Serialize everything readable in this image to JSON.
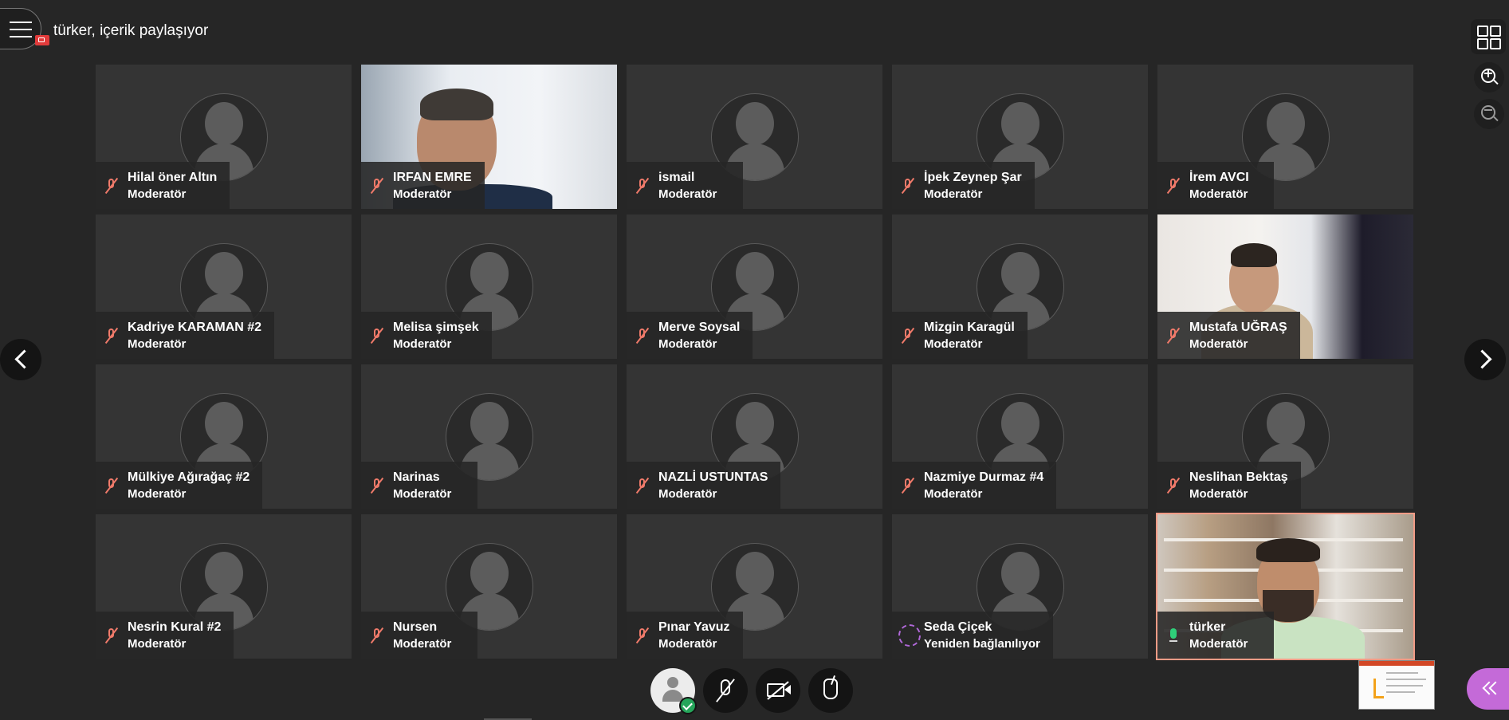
{
  "presenter": "türker, içerik paylaşıyor",
  "participants": [
    {
      "name": "Hilal öner Altın",
      "role": "Moderatör",
      "status": "muted",
      "video": false
    },
    {
      "name": "IRFAN EMRE",
      "role": "Moderatör",
      "status": "muted",
      "video": true
    },
    {
      "name": "ismail",
      "role": "Moderatör",
      "status": "muted",
      "video": false
    },
    {
      "name": "İpek Zeynep Şar",
      "role": "Moderatör",
      "status": "muted",
      "video": false
    },
    {
      "name": "İrem AVCI",
      "role": "Moderatör",
      "status": "muted",
      "video": false
    },
    {
      "name": "Kadriye KARAMAN #2",
      "role": "Moderatör",
      "status": "muted",
      "video": false
    },
    {
      "name": "Melisa şimşek",
      "role": "Moderatör",
      "status": "muted",
      "video": false
    },
    {
      "name": "Merve Soysal",
      "role": "Moderatör",
      "status": "muted",
      "video": false
    },
    {
      "name": "Mizgin Karagül",
      "role": "Moderatör",
      "status": "muted",
      "video": false
    },
    {
      "name": "Mustafa UĞRAŞ",
      "role": "Moderatör",
      "status": "muted",
      "video": true
    },
    {
      "name": "Mülkiye Ağırağaç #2",
      "role": "Moderatör",
      "status": "muted",
      "video": false
    },
    {
      "name": "Narinas",
      "role": "Moderatör",
      "status": "muted",
      "video": false
    },
    {
      "name": "NAZLİ USTUNTAS",
      "role": "Moderatör",
      "status": "muted",
      "video": false
    },
    {
      "name": "Nazmiye Durmaz #4",
      "role": "Moderatör",
      "status": "muted",
      "video": false
    },
    {
      "name": "Neslihan Bektaş",
      "role": "Moderatör",
      "status": "muted",
      "video": false
    },
    {
      "name": "Nesrin Kural #2",
      "role": "Moderatör",
      "status": "muted",
      "video": false
    },
    {
      "name": "Nursen",
      "role": "Moderatör",
      "status": "muted",
      "video": false
    },
    {
      "name": "Pınar Yavuz",
      "role": "Moderatör",
      "status": "muted",
      "video": false
    },
    {
      "name": "Seda Çiçek",
      "role": "Yeniden bağlanılıyor",
      "status": "reconnecting",
      "video": false
    },
    {
      "name": "türker",
      "role": "Moderatör",
      "status": "speaking",
      "video": true,
      "active": true
    }
  ],
  "colors": {
    "muted_icon": "#f07a6a",
    "mic_on": "#2fd07a",
    "reconnecting": "#b068d8",
    "active_border": "#f29b86",
    "collab_panel": "#c46ad8"
  },
  "icons": {
    "menu": "hamburger-icon",
    "sharing": "share-screen-icon",
    "grid_view": "grid-icon",
    "zoom_in": "zoom-in-icon",
    "zoom_out": "zoom-out-icon",
    "prev": "chevron-left-icon",
    "next": "chevron-right-icon",
    "avatar": "person-icon",
    "mic": "microphone-off-icon",
    "camera": "camera-off-icon",
    "hand": "raise-hand-icon",
    "collab": "double-chevron-left-icon"
  }
}
